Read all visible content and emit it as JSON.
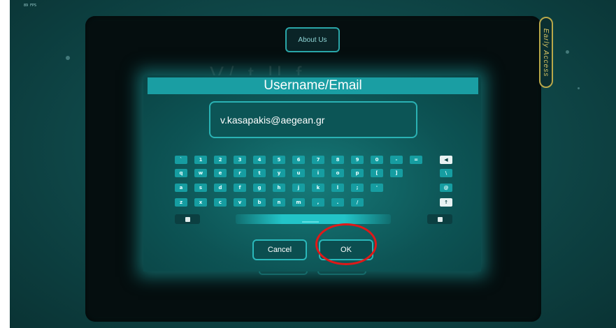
{
  "hud": {
    "fps": "89 FPS"
  },
  "background": {
    "about_label": "About Us",
    "early_access_label": "Early Access",
    "title_fragment": "V/      t   ll  f"
  },
  "dialog": {
    "title": "Username/Email",
    "input_value": "v.kasapakis@aegean.gr",
    "cancel_label": "Cancel",
    "ok_label": "OK"
  },
  "keyboard": {
    "rows": [
      [
        "`",
        "1",
        "2",
        "3",
        "4",
        "5",
        "6",
        "7",
        "8",
        "9",
        "0",
        "-",
        "=",
        "◀"
      ],
      [
        "q",
        "w",
        "e",
        "r",
        "t",
        "y",
        "u",
        "i",
        "o",
        "p",
        "[",
        "]",
        "\\"
      ],
      [
        "a",
        "s",
        "d",
        "f",
        "g",
        "h",
        "j",
        "k",
        "l",
        ";",
        "'",
        "@"
      ],
      [
        "z",
        "x",
        "c",
        "v",
        "b",
        "n",
        "m",
        ",",
        ".",
        "/",
        "↑"
      ]
    ],
    "left_util_icon": "copy-icon",
    "right_util_icon": "square-icon"
  },
  "colors": {
    "accent": "#1a9ea3",
    "annotation": "#e01818",
    "early_access": "#d4c263"
  }
}
